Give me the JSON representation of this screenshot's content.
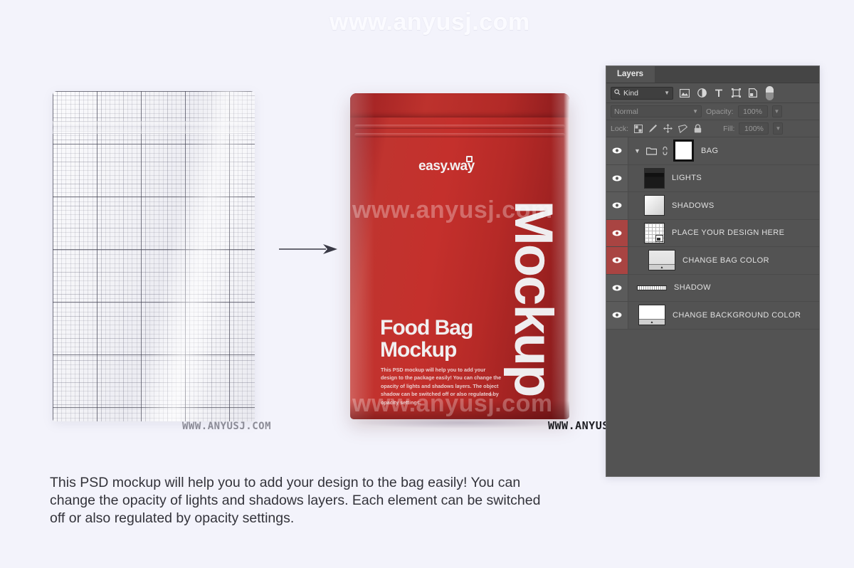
{
  "background_color": "#f3f3fb",
  "watermarks": {
    "top": "www.anyusj.com",
    "bag_upper": "www.anyusj.com",
    "bag_lower": "www.anyusj.com",
    "bottom_left": "WWW.ANYUSJ.COM",
    "bottom_right": "WWW.ANYUSJ.COM"
  },
  "template": {
    "label": "flat-grid-bag-template"
  },
  "arrow": {
    "label": "arrow-right"
  },
  "bag": {
    "color": "#b52b28",
    "logo": "easy.way",
    "trademark": "TM",
    "title": "Food Bag\nMockup",
    "body": "This PSD mockup will help you to add your design to the package easily! You can change the opacity of lights and shadows layers. The object shadow can be switched off or also regulated by opacity settings.",
    "vertical_text": "Mockup"
  },
  "panel": {
    "tab": "Layers",
    "filter": {
      "kind_label": "Kind",
      "search_icon": "search-icon",
      "icons": [
        "pixel-layer-icon",
        "adjustment-layer-icon",
        "type-layer-icon",
        "shape-layer-icon",
        "smart-object-icon"
      ],
      "toggle": "filter-toggle"
    },
    "blend": {
      "mode": "Normal",
      "opacity_label": "Opacity:",
      "opacity_value": "100%"
    },
    "lock": {
      "label": "Lock:",
      "icons": [
        "lock-transparent-pixels-icon",
        "lock-image-pixels-icon",
        "lock-position-icon",
        "lock-artboard-icon",
        "lock-all-icon"
      ],
      "fill_label": "Fill:",
      "fill_value": "100%"
    },
    "layers": [
      {
        "name": "BAG",
        "visible": true,
        "selected": false,
        "group": true,
        "masked": true,
        "linked": true,
        "thumb": "mask"
      },
      {
        "name": "LIGHTS",
        "visible": true,
        "selected": false,
        "group": false,
        "thumb": "lights"
      },
      {
        "name": "SHADOWS",
        "visible": true,
        "selected": false,
        "group": false,
        "thumb": "shadows"
      },
      {
        "name": "PLACE YOUR DESIGN HERE",
        "visible": true,
        "selected": true,
        "group": false,
        "thumb": "smart-object-grid"
      },
      {
        "name": "CHANGE BAG COLOR",
        "visible": true,
        "selected": true,
        "group": false,
        "thumb": "solid-adjustment"
      },
      {
        "name": "SHADOW",
        "visible": true,
        "selected": false,
        "group": false,
        "thumb": "shadow-strip"
      },
      {
        "name": "CHANGE BACKGROUND COLOR",
        "visible": true,
        "selected": false,
        "group": false,
        "thumb": "white-adjustment"
      }
    ],
    "selected_highlight_color": "#a94442"
  },
  "caption": "This PSD mockup will help you to add your design to the bag easily!  You can\nchange the opacity of lights and shadows layers. Each element can be switched\noff or also regulated by opacity settings."
}
